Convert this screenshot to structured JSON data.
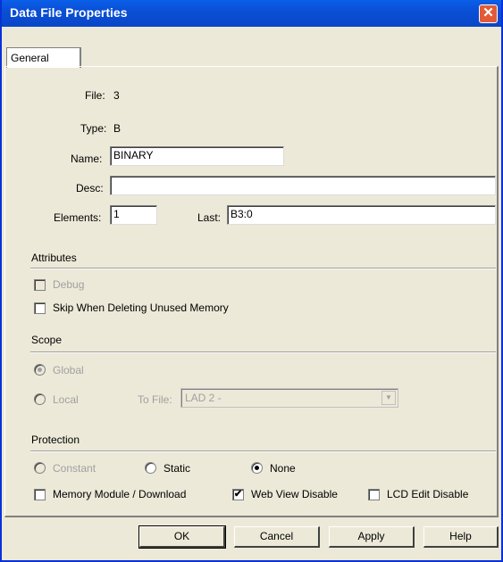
{
  "window": {
    "title": "Data File Properties",
    "close_glyph": "✕"
  },
  "tabs": [
    {
      "label": "General"
    }
  ],
  "general": {
    "file_label": "File:",
    "file_value": "3",
    "type_label": "Type:",
    "type_value": "B",
    "name_label": "Name:",
    "name_value": "BINARY",
    "desc_label": "Desc:",
    "desc_value": "",
    "elements_label": "Elements:",
    "elements_value": "1",
    "last_label": "Last:",
    "last_value": "B3:0"
  },
  "attributes": {
    "heading": "Attributes",
    "debug": {
      "label": "Debug",
      "checked": false,
      "enabled": false
    },
    "skip_unused": {
      "label": "Skip When Deleting Unused Memory",
      "checked": false,
      "enabled": true
    }
  },
  "scope": {
    "heading": "Scope",
    "global": {
      "label": "Global",
      "selected": true,
      "enabled": false
    },
    "local": {
      "label": "Local",
      "selected": false,
      "enabled": false
    },
    "to_file_label": "To File:",
    "to_file_value": "LAD 2 -"
  },
  "protection": {
    "heading": "Protection",
    "constant": {
      "label": "Constant",
      "selected": false,
      "enabled": false
    },
    "static": {
      "label": "Static",
      "selected": false,
      "enabled": true
    },
    "none": {
      "label": "None",
      "selected": true,
      "enabled": true
    },
    "memory_module": {
      "label": "Memory Module / Download",
      "checked": false
    },
    "web_view_disable": {
      "label": "Web View Disable",
      "checked": true
    },
    "lcd_edit_disable": {
      "label": "LCD Edit Disable",
      "checked": false
    }
  },
  "buttons": {
    "ok": "OK",
    "cancel": "Cancel",
    "apply": "Apply",
    "help": "Help"
  },
  "glyphs": {
    "check": "✔",
    "dropdown": "▼"
  },
  "colors": {
    "titlebar": "#0a50d8",
    "close": "#e25b36",
    "dialog_bg": "#ece9d8"
  }
}
